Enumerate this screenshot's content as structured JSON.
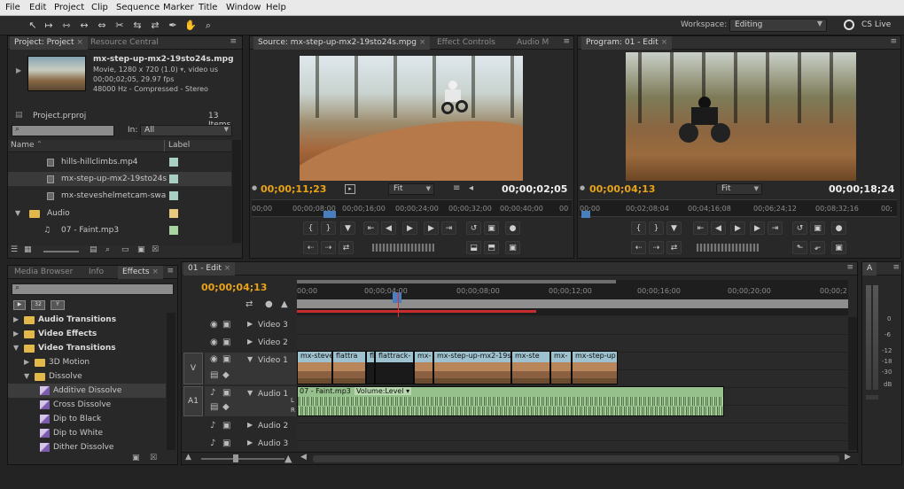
{
  "menu": {
    "items": [
      "File",
      "Edit",
      "Project",
      "Clip",
      "Sequence",
      "Marker",
      "Title",
      "Window",
      "Help"
    ]
  },
  "toolbar": {
    "tools": [
      "selection-tool-icon",
      "track-select-tool-icon",
      "ripple-edit-tool-icon",
      "rolling-edit-tool-icon",
      "rate-stretch-tool-icon",
      "razor-tool-icon",
      "slip-tool-icon",
      "slide-tool-icon",
      "pen-tool-icon",
      "hand-tool-icon",
      "zoom-tool-icon"
    ],
    "workspace_label": "Workspace:",
    "workspace_value": "Editing",
    "cs_live": "CS Live"
  },
  "project": {
    "tabs": [
      "Project: Project",
      "Resource Central"
    ],
    "clip_name": "mx-step-up-mx2-19sto24s.mpg",
    "clip_info_1": "Movie, 1280 x 720 (1.0)",
    "clip_info_1b": ", video us",
    "clip_info_2": "00;00;02;05, 29.97 fps",
    "clip_info_3": "48000 Hz - Compressed - Stereo",
    "project_file": "Project.prproj",
    "item_count": "13 Items",
    "in_label": "In:",
    "in_value": "All",
    "col_name": "Name",
    "col_label": "Label",
    "items": [
      {
        "name": "hills-hillclimbs.mp4",
        "color": "#a8cfc4",
        "indent": 1
      },
      {
        "name": "mx-step-up-mx2-19sto24s",
        "color": "#a8cfc4",
        "indent": 1
      },
      {
        "name": "mx-steveshelmetcam-swa",
        "color": "#a8cfc4",
        "indent": 1
      },
      {
        "name": "Audio",
        "color": "#e9c97f",
        "indent": 0
      },
      {
        "name": "07 - Faint.mp3",
        "color": "#a8d4a0",
        "indent": 1
      }
    ]
  },
  "source": {
    "tabs": [
      "Source: mx-step-up-mx2-19sto24s.mpg",
      "Effect Controls",
      "Audio M"
    ],
    "timecode_in": "00;00;11;23",
    "fit": "Fit",
    "timecode_dur": "00;00;02;05",
    "ruler_labels": [
      "00;00",
      "00;00;08;00",
      "00;00;16;00",
      "00;00;24;00",
      "00;00;32;00",
      "00;00;40;00",
      "00"
    ]
  },
  "program": {
    "tabs": [
      "Program: 01 - Edit"
    ],
    "timecode_in": "00;00;04;13",
    "fit": "Fit",
    "timecode_dur": "00;00;18;24",
    "ruler_labels": [
      "00;00",
      "00;02;08;04",
      "00;04;16;08",
      "00;06;24;12",
      "00;08;32;16",
      "00;"
    ]
  },
  "effects": {
    "tabs": [
      "Media Browser",
      "Info",
      "Effects"
    ],
    "tree": [
      {
        "label": "Audio Transitions",
        "level": 0,
        "bold": true,
        "type": "folder"
      },
      {
        "label": "Video Effects",
        "level": 0,
        "bold": true,
        "type": "folder"
      },
      {
        "label": "Video Transitions",
        "level": 0,
        "bold": true,
        "type": "folder"
      },
      {
        "label": "3D Motion",
        "level": 1,
        "bold": false,
        "type": "folder"
      },
      {
        "label": "Dissolve",
        "level": 1,
        "bold": false,
        "type": "folder"
      },
      {
        "label": "Additive Dissolve",
        "level": 2,
        "bold": false,
        "type": "effect"
      },
      {
        "label": "Cross Dissolve",
        "level": 2,
        "bold": false,
        "type": "effect"
      },
      {
        "label": "Dip to Black",
        "level": 2,
        "bold": false,
        "type": "effect"
      },
      {
        "label": "Dip to White",
        "level": 2,
        "bold": false,
        "type": "effect"
      },
      {
        "label": "Dither Dissolve",
        "level": 2,
        "bold": false,
        "type": "effect"
      }
    ]
  },
  "timeline": {
    "tab": "01 - Edit",
    "timecode": "00;00;04;13",
    "ruler_labels": [
      "00;00",
      "00;00;04;00",
      "00;00;08;00",
      "00;00;12;00",
      "00;00;16;00",
      "00;00;20;00",
      "00;00;2"
    ],
    "tracks": {
      "video3": "Video 3",
      "video2": "Video 2",
      "video1": "Video 1",
      "audio1": "Audio 1",
      "audio2": "Audio 2",
      "audio3": "Audio 3",
      "v_target": "V",
      "a_target": "A1"
    },
    "video_clips": [
      "mx-steve",
      "flattra",
      "fl",
      "flattrack-",
      "mx-",
      "mx-step-up-mx2-19s",
      "mx-ste",
      "mx-",
      "mx-step-up"
    ],
    "audio_clip": "07 - Faint.mp3",
    "audio_clip_prop": "Volume:Level",
    "audio_channels": [
      "L",
      "R"
    ]
  },
  "audio_meter": {
    "tab": "A",
    "db_labels": [
      "0",
      "-6",
      "-12",
      "-18",
      "-30",
      "dB"
    ]
  }
}
